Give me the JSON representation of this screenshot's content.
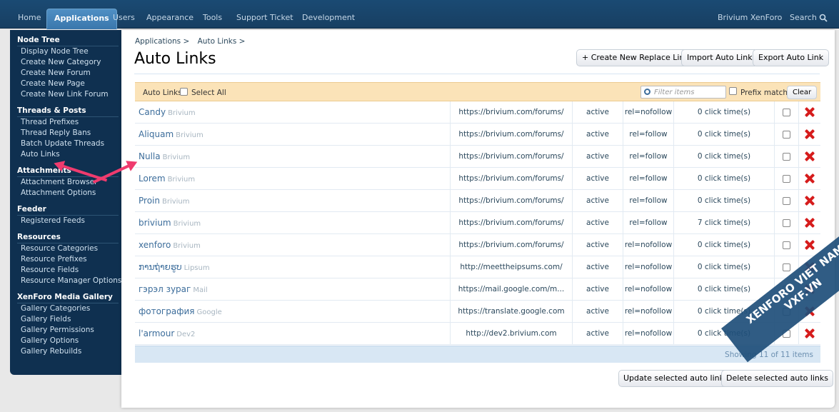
{
  "topnav": {
    "tabs": [
      "Home",
      "Applications",
      "Users",
      "Appearance",
      "Tools",
      "Support Ticket",
      "Development"
    ],
    "right_link": "Brivium XenForo",
    "search": "Search"
  },
  "sidebar": {
    "sections": [
      {
        "title": "Node Tree",
        "links": [
          "Display Node Tree",
          "Create New Category",
          "Create New Forum",
          "Create New Page",
          "Create New Link Forum"
        ]
      },
      {
        "title": "Threads & Posts",
        "links": [
          "Thread Prefixes",
          "Thread Reply Bans",
          "Batch Update Threads",
          "Auto Links"
        ]
      },
      {
        "title": "Attachments",
        "links": [
          "Attachment Browser",
          "Attachment Options"
        ]
      },
      {
        "title": "Feeder",
        "links": [
          "Registered Feeds"
        ]
      },
      {
        "title": "Resources",
        "links": [
          "Resource Categories",
          "Resource Prefixes",
          "Resource Fields",
          "Resource Manager Options"
        ]
      },
      {
        "title": "XenForo Media Gallery",
        "links": [
          "Gallery Categories",
          "Gallery Fields",
          "Gallery Permissions",
          "Gallery Options",
          "Gallery Rebuilds"
        ]
      }
    ]
  },
  "breadcrumb": [
    "Applications >",
    "Auto Links >"
  ],
  "page_title": "Auto Links",
  "actions": {
    "create": "+ Create New Replace Link",
    "import": "Import Auto Link",
    "export": "Export Auto Link"
  },
  "filter": {
    "label": "Auto Links",
    "select_all": "Select All",
    "placeholder": "Filter items",
    "prefix_match": "Prefix match",
    "clear": "Clear"
  },
  "rows": [
    {
      "word": "Candy",
      "group": "Brivium",
      "url": "https://brivium.com/forums/",
      "status": "active",
      "rel": "rel=nofollow",
      "clicks": "0 click time(s)"
    },
    {
      "word": "Aliquam",
      "group": "Brivium",
      "url": "https://brivium.com/forums/",
      "status": "active",
      "rel": "rel=follow",
      "clicks": "0 click time(s)"
    },
    {
      "word": "Nulla",
      "group": "Brivium",
      "url": "https://brivium.com/forums/",
      "status": "active",
      "rel": "rel=follow",
      "clicks": "0 click time(s)"
    },
    {
      "word": "Lorem",
      "group": "Brivium",
      "url": "https://brivium.com/forums/",
      "status": "active",
      "rel": "rel=follow",
      "clicks": "0 click time(s)"
    },
    {
      "word": "Proin",
      "group": "Brivium",
      "url": "https://brivium.com/forums/",
      "status": "active",
      "rel": "rel=follow",
      "clicks": "0 click time(s)"
    },
    {
      "word": "brivium",
      "group": "Brivium",
      "url": "https://brivium.com/forums/",
      "status": "active",
      "rel": "rel=follow",
      "clicks": "7 click time(s)"
    },
    {
      "word": "xenforo",
      "group": "Brivium",
      "url": "https://brivium.com/forums/",
      "status": "active",
      "rel": "rel=nofollow",
      "clicks": "0 click time(s)"
    },
    {
      "word": "ການຖ່າຍຮູບ",
      "group": "Lipsum",
      "url": "http://meettheipsums.com/",
      "status": "active",
      "rel": "rel=nofollow",
      "clicks": "0 click time(s)"
    },
    {
      "word": "гэрэл зураг",
      "group": "Mail",
      "url": "https://mail.google.com/m...",
      "status": "active",
      "rel": "rel=nofollow",
      "clicks": "0 click time(s)"
    },
    {
      "word": "фотография",
      "group": "Google",
      "url": "https://translate.google.com",
      "status": "active",
      "rel": "rel=nofollow",
      "clicks": "0 click time(s)"
    },
    {
      "word": "l'armour",
      "group": "Dev2",
      "url": "http://dev2.brivium.com",
      "status": "active",
      "rel": "rel=nofollow",
      "clicks": "0 click time(s)"
    }
  ],
  "showing": "Showing 11 of 11 items",
  "bottom": {
    "update": "Update selected auto links",
    "delete": "Delete selected auto links"
  },
  "watermark": {
    "line1": "XENFORO VIET NAM",
    "line2": "VXF.VN"
  }
}
